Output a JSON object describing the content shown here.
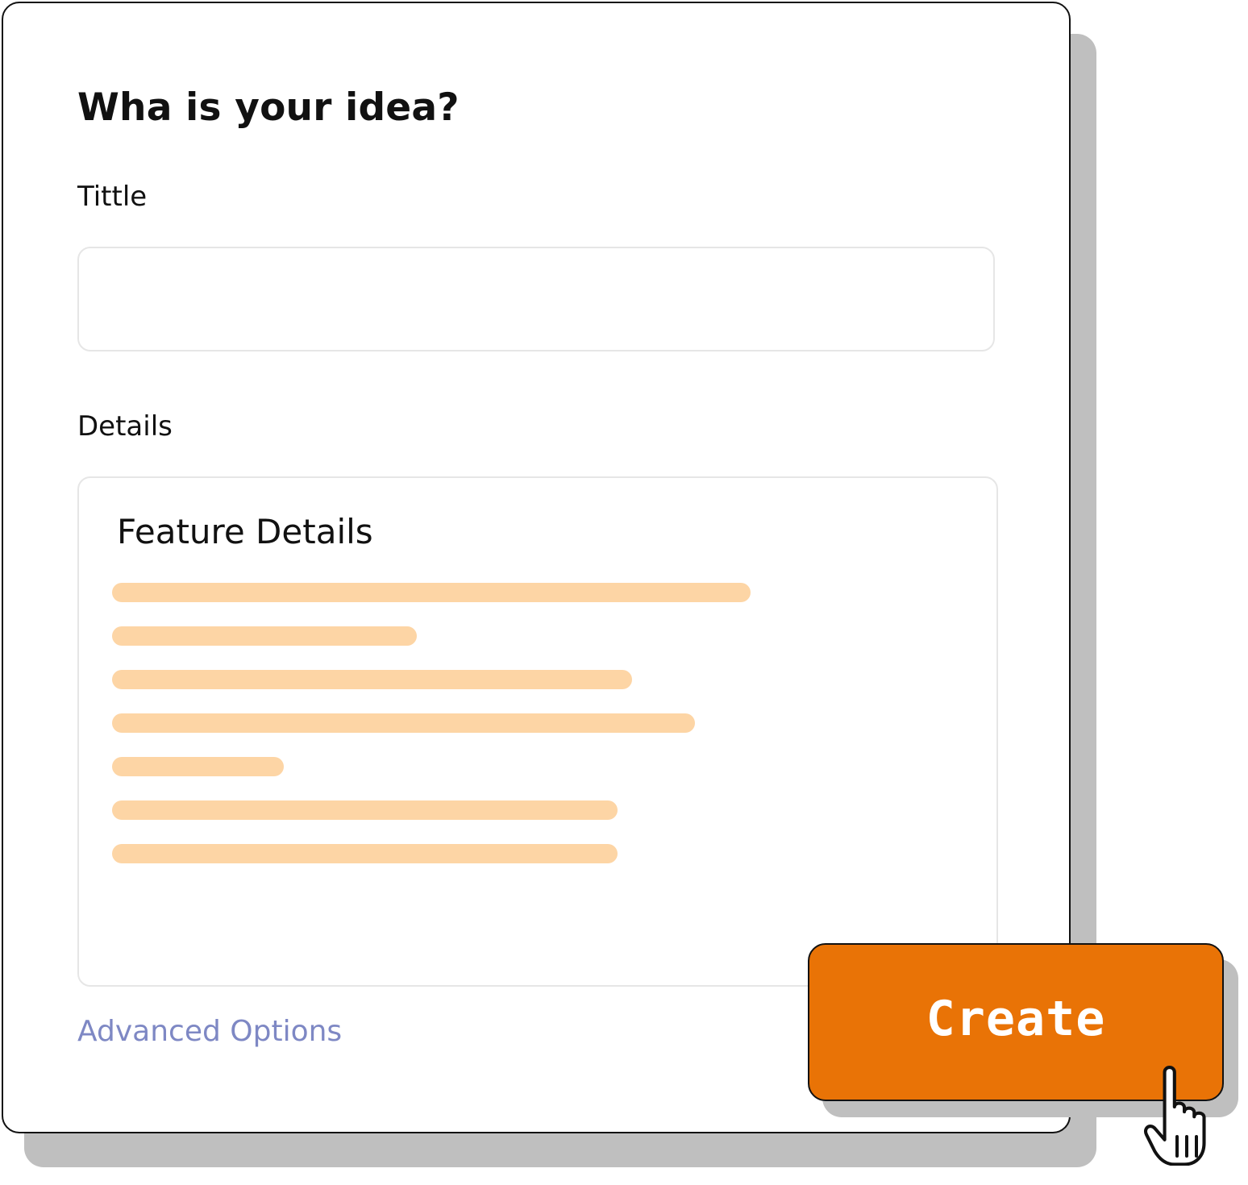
{
  "form": {
    "heading": "Wha is your idea?",
    "title_label": "Tittle",
    "title_value": "",
    "details_label": "Details",
    "details_heading": "Feature Details",
    "advanced_link": "Advanced Options",
    "create_button": "Create"
  },
  "colors": {
    "accent": "#e97306",
    "placeholder_line": "#fdd5a5",
    "link": "#7e88c4",
    "shadow": "#bfbfbf",
    "text": "#111111"
  },
  "icons": {
    "cursor": "hand-pointer-icon"
  }
}
